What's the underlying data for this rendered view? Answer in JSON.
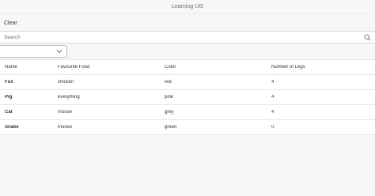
{
  "app": {
    "title": "Learning UI5"
  },
  "toolbar": {
    "clear_label": "Clear"
  },
  "search": {
    "placeholder": "Search",
    "value": ""
  },
  "filter": {
    "selected": ""
  },
  "table": {
    "columns": [
      "Name",
      "Favourite Food",
      "Color",
      "Number of Legs"
    ],
    "rows": [
      [
        "Fox",
        "chicken",
        "red",
        "4"
      ],
      [
        "Pig",
        "everything",
        "pink",
        "4"
      ],
      [
        "Cat",
        "mouse",
        "grey",
        "4"
      ],
      [
        "Snake",
        "mouse",
        "green",
        "0"
      ]
    ]
  },
  "icons": {
    "search": "search-icon",
    "dropdown": "chevron-down-icon"
  }
}
